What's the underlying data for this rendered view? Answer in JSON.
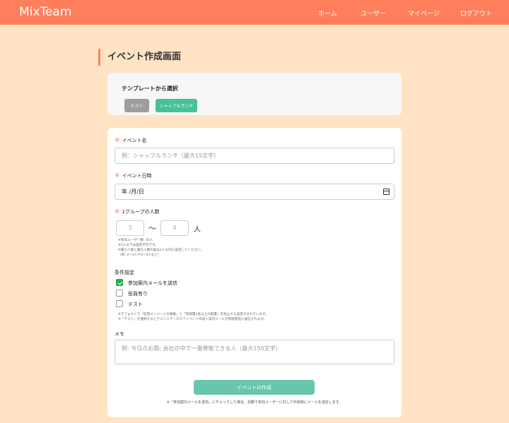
{
  "header": {
    "logo": "MixTeam",
    "nav": [
      "ホーム",
      "ユーザー",
      "マイページ",
      "ログアウト"
    ]
  },
  "page_title": "イベント作成画面",
  "template": {
    "title": "テンプレートから選択",
    "buttons": [
      "テスト",
      "シャッフルランチ"
    ]
  },
  "form": {
    "required_mark": "※",
    "event_name": {
      "label": "イベント名",
      "placeholder": "例：シャッフルランチ（最大15文字）"
    },
    "event_date": {
      "label": "イベント日時",
      "value": "年 /月/日"
    },
    "group_size": {
      "label": "1グループの人数",
      "min": "3",
      "max": "4",
      "tilde": "〜",
      "unit": "人",
      "notes": [
        "※有効ユーザー数: 35人",
        "※2人以下は設定不可です。",
        "※最小人数と最大人数の差は1人以内に設定してください。",
        "（例: 2〜3人や3〜4人など）"
      ]
    },
    "conditions": {
      "label": "条件設定",
      "options": [
        {
          "label": "参加案内メールを送信",
          "checked": true
        },
        {
          "label": "役員有り",
          "checked": false
        },
        {
          "label": "テスト",
          "checked": false
        }
      ],
      "notes": [
        "※デフォルトで「前回メンバーとの重複」と「同部署2名以上の配置」を防止する設定がされています。",
        "※「テスト」を選択するとテストステータスでイベント作成＋案内メールが管理者宛に送信されます。"
      ]
    },
    "memo": {
      "label": "メモ",
      "placeholder": "例: 今日のお題: 会社の中で一番尊敬できる人（最大150文字）"
    },
    "submit_label": "イベントの作成",
    "footnote": "※「参加案内メールを送信」にチェックした場合、自動で有効ユーザーに対して作成時にメールを送信します。"
  },
  "colors": {
    "accent": "#ff7f5c",
    "background": "#ffe3c4",
    "submit": "#68c6ae",
    "template_lunch": "#45c29a",
    "checkbox_checked": "#2ea84a"
  }
}
